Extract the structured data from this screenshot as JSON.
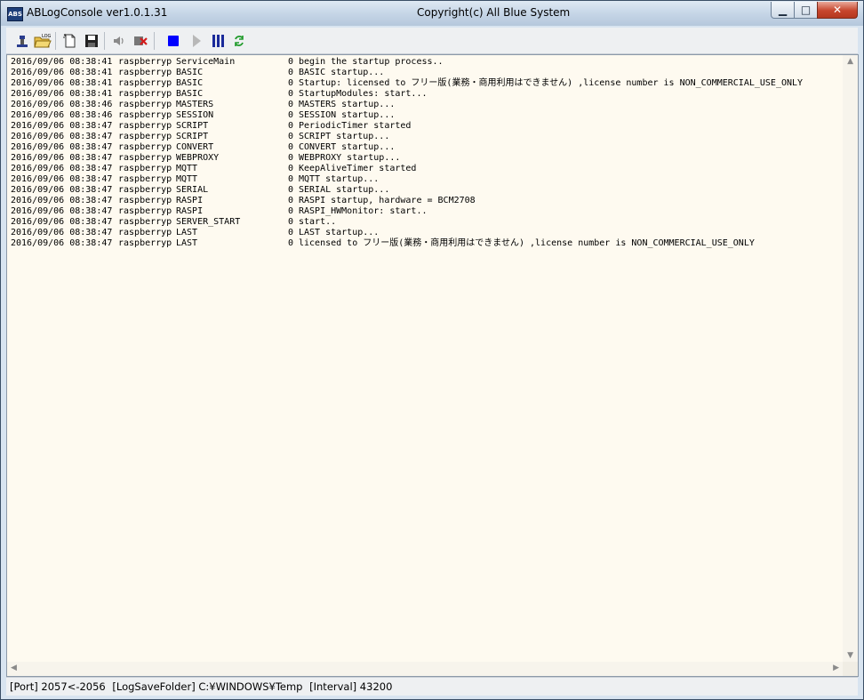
{
  "window": {
    "title": "ABLogConsole ver1.0.1.31",
    "copyright": "Copyright(c) All Blue System",
    "app_icon_text": "ABS",
    "controls": {
      "minimize": "▁",
      "maximize": "□",
      "close": "✕"
    }
  },
  "toolbar": {
    "buttons": [
      {
        "name": "connect-icon",
        "label": ""
      },
      {
        "name": "open-log-folder-icon",
        "label": "LOG"
      },
      {
        "name": "new-document-icon",
        "label": ""
      },
      {
        "name": "save-icon",
        "label": ""
      },
      {
        "name": "speaker-icon",
        "label": ""
      },
      {
        "name": "clear-icon",
        "label": ""
      },
      {
        "name": "stop-icon",
        "label": ""
      },
      {
        "name": "play-icon",
        "label": ""
      },
      {
        "name": "pause-icon",
        "label": ""
      },
      {
        "name": "refresh-icon",
        "label": ""
      }
    ]
  },
  "log": {
    "lines": [
      {
        "date": "2016/09/06 08:38:41",
        "host": "raspberryp",
        "module": "ServiceMain",
        "level": "0",
        "message": "begin the startup process.."
      },
      {
        "date": "2016/09/06 08:38:41",
        "host": "raspberryp",
        "module": "BASIC",
        "level": "0",
        "message": "BASIC startup..."
      },
      {
        "date": "2016/09/06 08:38:41",
        "host": "raspberryp",
        "module": "BASIC",
        "level": "0",
        "message": "Startup: licensed to フリー版(業務・商用利用はできません) ,license number is NON_COMMERCIAL_USE_ONLY"
      },
      {
        "date": "2016/09/06 08:38:41",
        "host": "raspberryp",
        "module": "BASIC",
        "level": "0",
        "message": "StartupModules: start..."
      },
      {
        "date": "2016/09/06 08:38:46",
        "host": "raspberryp",
        "module": "MASTERS",
        "level": "0",
        "message": "MASTERS startup..."
      },
      {
        "date": "2016/09/06 08:38:46",
        "host": "raspberryp",
        "module": "SESSION",
        "level": "0",
        "message": "SESSION startup..."
      },
      {
        "date": "2016/09/06 08:38:47",
        "host": "raspberryp",
        "module": "SCRIPT",
        "level": "0",
        "message": "PeriodicTimer started"
      },
      {
        "date": "2016/09/06 08:38:47",
        "host": "raspberryp",
        "module": "SCRIPT",
        "level": "0",
        "message": "SCRIPT startup..."
      },
      {
        "date": "2016/09/06 08:38:47",
        "host": "raspberryp",
        "module": "CONVERT",
        "level": "0",
        "message": "CONVERT startup..."
      },
      {
        "date": "2016/09/06 08:38:47",
        "host": "raspberryp",
        "module": "WEBPROXY",
        "level": "0",
        "message": "WEBPROXY startup..."
      },
      {
        "date": "2016/09/06 08:38:47",
        "host": "raspberryp",
        "module": "MQTT",
        "level": "0",
        "message": "KeepAliveTimer started"
      },
      {
        "date": "2016/09/06 08:38:47",
        "host": "raspberryp",
        "module": "MQTT",
        "level": "0",
        "message": "MQTT startup..."
      },
      {
        "date": "2016/09/06 08:38:47",
        "host": "raspberryp",
        "module": "SERIAL",
        "level": "0",
        "message": "SERIAL startup..."
      },
      {
        "date": "2016/09/06 08:38:47",
        "host": "raspberryp",
        "module": "RASPI",
        "level": "0",
        "message": "RASPI startup, hardware = BCM2708"
      },
      {
        "date": "2016/09/06 08:38:47",
        "host": "raspberryp",
        "module": "RASPI",
        "level": "0",
        "message": "RASPI_HWMonitor: start.."
      },
      {
        "date": "2016/09/06 08:38:47",
        "host": "raspberryp",
        "module": "SERVER_START",
        "level": "0",
        "message": "start.."
      },
      {
        "date": "2016/09/06 08:38:47",
        "host": "raspberryp",
        "module": "LAST",
        "level": "0",
        "message": "LAST startup..."
      },
      {
        "date": "2016/09/06 08:38:47",
        "host": "raspberryp",
        "module": "LAST",
        "level": "0",
        "message": "licensed to フリー版(業務・商用利用はできません) ,license number is NON_COMMERCIAL_USE_ONLY"
      }
    ]
  },
  "status": {
    "port": "[Port] 2057<-2056",
    "log_save_folder": "[LogSaveFolder] C:¥WINDOWS¥Temp",
    "interval": "[Interval] 43200"
  },
  "colors": {
    "log_background": "#fefaf0",
    "close_button": "#c7462d",
    "stop_icon": "#0000ff"
  }
}
